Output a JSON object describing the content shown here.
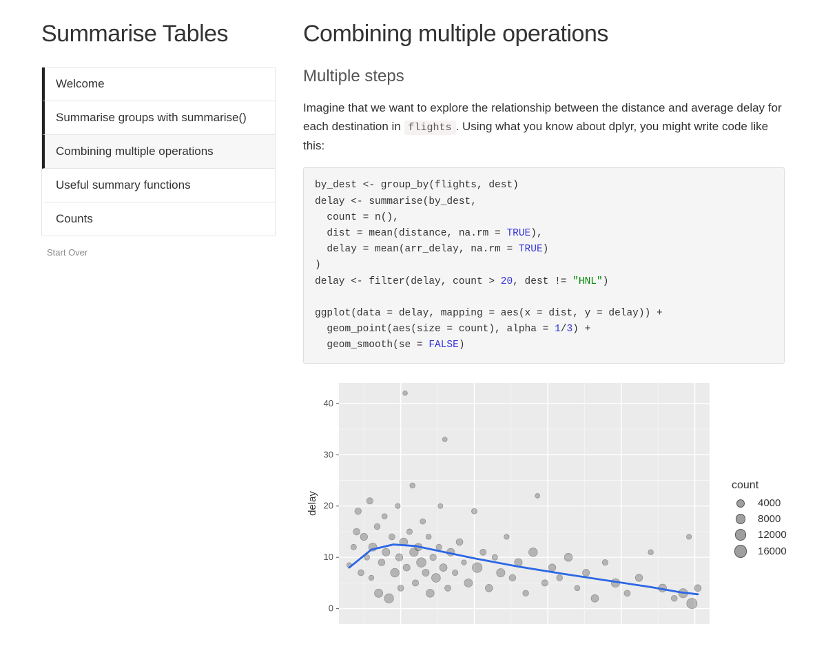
{
  "sidebar": {
    "title": "Summarise Tables",
    "items": [
      {
        "label": "Welcome",
        "state": "completed"
      },
      {
        "label": "Summarise groups with summarise()",
        "state": "completed"
      },
      {
        "label": "Combining multiple operations",
        "state": "active"
      },
      {
        "label": "Useful summary functions",
        "state": ""
      },
      {
        "label": "Counts",
        "state": ""
      }
    ],
    "start_over": "Start Over"
  },
  "main": {
    "title": "Combining multiple operations",
    "section_title": "Multiple steps",
    "paragraph_pre": "Imagine that we want to explore the relationship between the distance and average delay for each destination in ",
    "paragraph_code": "flights",
    "paragraph_post": ". Using what you know about dplyr, you might write code like this:",
    "code_tokens": [
      {
        "t": "by_dest <- group_by(flights, dest)"
      },
      {
        "t": "\ndelay <- summarise(by_dest,"
      },
      {
        "t": "\n  count = n(),"
      },
      {
        "t": "\n  dist = mean(distance, na.rm = "
      },
      {
        "t": "TRUE",
        "c": "kw"
      },
      {
        "t": "),"
      },
      {
        "t": "\n  delay = mean(arr_delay, na.rm = "
      },
      {
        "t": "TRUE",
        "c": "kw"
      },
      {
        "t": ")"
      },
      {
        "t": "\n)"
      },
      {
        "t": "\ndelay <- filter(delay, count > "
      },
      {
        "t": "20",
        "c": "num"
      },
      {
        "t": ", dest != "
      },
      {
        "t": "\"HNL\"",
        "c": "str"
      },
      {
        "t": ")"
      },
      {
        "t": "\n"
      },
      {
        "t": "\nggplot(data = delay, mapping = aes(x = dist, y = delay)) +"
      },
      {
        "t": "\n  geom_point(aes(size = count), alpha = "
      },
      {
        "t": "1",
        "c": "num"
      },
      {
        "t": "/"
      },
      {
        "t": "3",
        "c": "num"
      },
      {
        "t": ") +"
      },
      {
        "t": "\n  geom_smooth(se = "
      },
      {
        "t": "FALSE",
        "c": "kw"
      },
      {
        "t": ")"
      }
    ]
  },
  "chart_data": {
    "type": "scatter",
    "xlabel": "",
    "ylabel": "delay",
    "x_ticks": [],
    "y_ticks": [
      0,
      10,
      20,
      30,
      40
    ],
    "xlim": [
      80,
      2600
    ],
    "ylim": [
      -3,
      44
    ],
    "legend": {
      "title": "count",
      "entries": [
        {
          "label": "4000",
          "size": 4000
        },
        {
          "label": "8000",
          "size": 8000
        },
        {
          "label": "12000",
          "size": 12000
        },
        {
          "label": "16000",
          "size": 16000
        }
      ]
    },
    "points": [
      {
        "dist": 150,
        "delay": 8.5,
        "count": 1200
      },
      {
        "dist": 180,
        "delay": 12,
        "count": 2200
      },
      {
        "dist": 200,
        "delay": 15,
        "count": 4200
      },
      {
        "dist": 210,
        "delay": 19,
        "count": 3800
      },
      {
        "dist": 230,
        "delay": 7,
        "count": 3000
      },
      {
        "dist": 250,
        "delay": 14,
        "count": 5200
      },
      {
        "dist": 270,
        "delay": 10,
        "count": 2100
      },
      {
        "dist": 290,
        "delay": 21,
        "count": 3500
      },
      {
        "dist": 300,
        "delay": 6,
        "count": 1600
      },
      {
        "dist": 310,
        "delay": 12,
        "count": 7800
      },
      {
        "dist": 340,
        "delay": 16,
        "count": 2700
      },
      {
        "dist": 350,
        "delay": 3,
        "count": 8200
      },
      {
        "dist": 370,
        "delay": 9,
        "count": 4200
      },
      {
        "dist": 390,
        "delay": 18,
        "count": 1900
      },
      {
        "dist": 400,
        "delay": 11,
        "count": 6300
      },
      {
        "dist": 420,
        "delay": 2,
        "count": 11200
      },
      {
        "dist": 440,
        "delay": 14,
        "count": 3100
      },
      {
        "dist": 460,
        "delay": 7,
        "count": 9200
      },
      {
        "dist": 480,
        "delay": 20,
        "count": 1400
      },
      {
        "dist": 490,
        "delay": 10,
        "count": 5400
      },
      {
        "dist": 500,
        "delay": 4,
        "count": 2900
      },
      {
        "dist": 520,
        "delay": 13,
        "count": 7200
      },
      {
        "dist": 530,
        "delay": 42,
        "count": 900
      },
      {
        "dist": 540,
        "delay": 8,
        "count": 4600
      },
      {
        "dist": 560,
        "delay": 15,
        "count": 2300
      },
      {
        "dist": 580,
        "delay": 24,
        "count": 1800
      },
      {
        "dist": 590,
        "delay": 11,
        "count": 8900
      },
      {
        "dist": 600,
        "delay": 5,
        "count": 3400
      },
      {
        "dist": 620,
        "delay": 12,
        "count": 6100
      },
      {
        "dist": 640,
        "delay": 9,
        "count": 11800
      },
      {
        "dist": 650,
        "delay": 17,
        "count": 2000
      },
      {
        "dist": 670,
        "delay": 7,
        "count": 4800
      },
      {
        "dist": 690,
        "delay": 14,
        "count": 1700
      },
      {
        "dist": 700,
        "delay": 3,
        "count": 7400
      },
      {
        "dist": 720,
        "delay": 10,
        "count": 3700
      },
      {
        "dist": 740,
        "delay": 6,
        "count": 9600
      },
      {
        "dist": 760,
        "delay": 12,
        "count": 2500
      },
      {
        "dist": 770,
        "delay": 20,
        "count": 1300
      },
      {
        "dist": 790,
        "delay": 8,
        "count": 5900
      },
      {
        "dist": 800,
        "delay": 33,
        "count": 1100
      },
      {
        "dist": 820,
        "delay": 4,
        "count": 3100
      },
      {
        "dist": 840,
        "delay": 11,
        "count": 6700
      },
      {
        "dist": 870,
        "delay": 7,
        "count": 2400
      },
      {
        "dist": 900,
        "delay": 13,
        "count": 4300
      },
      {
        "dist": 930,
        "delay": 9,
        "count": 1600
      },
      {
        "dist": 960,
        "delay": 5,
        "count": 7900
      },
      {
        "dist": 1000,
        "delay": 19,
        "count": 2000
      },
      {
        "dist": 1020,
        "delay": 8,
        "count": 13200
      },
      {
        "dist": 1060,
        "delay": 11,
        "count": 3300
      },
      {
        "dist": 1100,
        "delay": 4,
        "count": 5600
      },
      {
        "dist": 1140,
        "delay": 10,
        "count": 2200
      },
      {
        "dist": 1180,
        "delay": 7,
        "count": 8400
      },
      {
        "dist": 1220,
        "delay": 14,
        "count": 1500
      },
      {
        "dist": 1260,
        "delay": 6,
        "count": 4000
      },
      {
        "dist": 1300,
        "delay": 9,
        "count": 6500
      },
      {
        "dist": 1350,
        "delay": 3,
        "count": 2700
      },
      {
        "dist": 1400,
        "delay": 11,
        "count": 9100
      },
      {
        "dist": 1430,
        "delay": 22,
        "count": 1000
      },
      {
        "dist": 1480,
        "delay": 5,
        "count": 3500
      },
      {
        "dist": 1530,
        "delay": 8,
        "count": 5200
      },
      {
        "dist": 1580,
        "delay": 6,
        "count": 2800
      },
      {
        "dist": 1640,
        "delay": 10,
        "count": 7300
      },
      {
        "dist": 1700,
        "delay": 4,
        "count": 1900
      },
      {
        "dist": 1760,
        "delay": 7,
        "count": 4600
      },
      {
        "dist": 1820,
        "delay": 2,
        "count": 6000
      },
      {
        "dist": 1890,
        "delay": 9,
        "count": 2400
      },
      {
        "dist": 1960,
        "delay": 5,
        "count": 8700
      },
      {
        "dist": 2040,
        "delay": 3,
        "count": 3200
      },
      {
        "dist": 2120,
        "delay": 6,
        "count": 5100
      },
      {
        "dist": 2200,
        "delay": 11,
        "count": 1700
      },
      {
        "dist": 2280,
        "delay": 4,
        "count": 7600
      },
      {
        "dist": 2360,
        "delay": 2,
        "count": 2900
      },
      {
        "dist": 2420,
        "delay": 3,
        "count": 10800
      },
      {
        "dist": 2460,
        "delay": 14,
        "count": 1400
      },
      {
        "dist": 2480,
        "delay": 1,
        "count": 15200
      },
      {
        "dist": 2520,
        "delay": 4,
        "count": 4400
      }
    ],
    "smooth": [
      {
        "x": 150,
        "y": 8.0
      },
      {
        "x": 300,
        "y": 11.5
      },
      {
        "x": 450,
        "y": 12.5
      },
      {
        "x": 600,
        "y": 12.2
      },
      {
        "x": 800,
        "y": 11.0
      },
      {
        "x": 1000,
        "y": 9.8
      },
      {
        "x": 1300,
        "y": 8.2
      },
      {
        "x": 1600,
        "y": 6.8
      },
      {
        "x": 1900,
        "y": 5.5
      },
      {
        "x": 2200,
        "y": 4.2
      },
      {
        "x": 2400,
        "y": 3.2
      },
      {
        "x": 2520,
        "y": 2.8
      }
    ]
  }
}
